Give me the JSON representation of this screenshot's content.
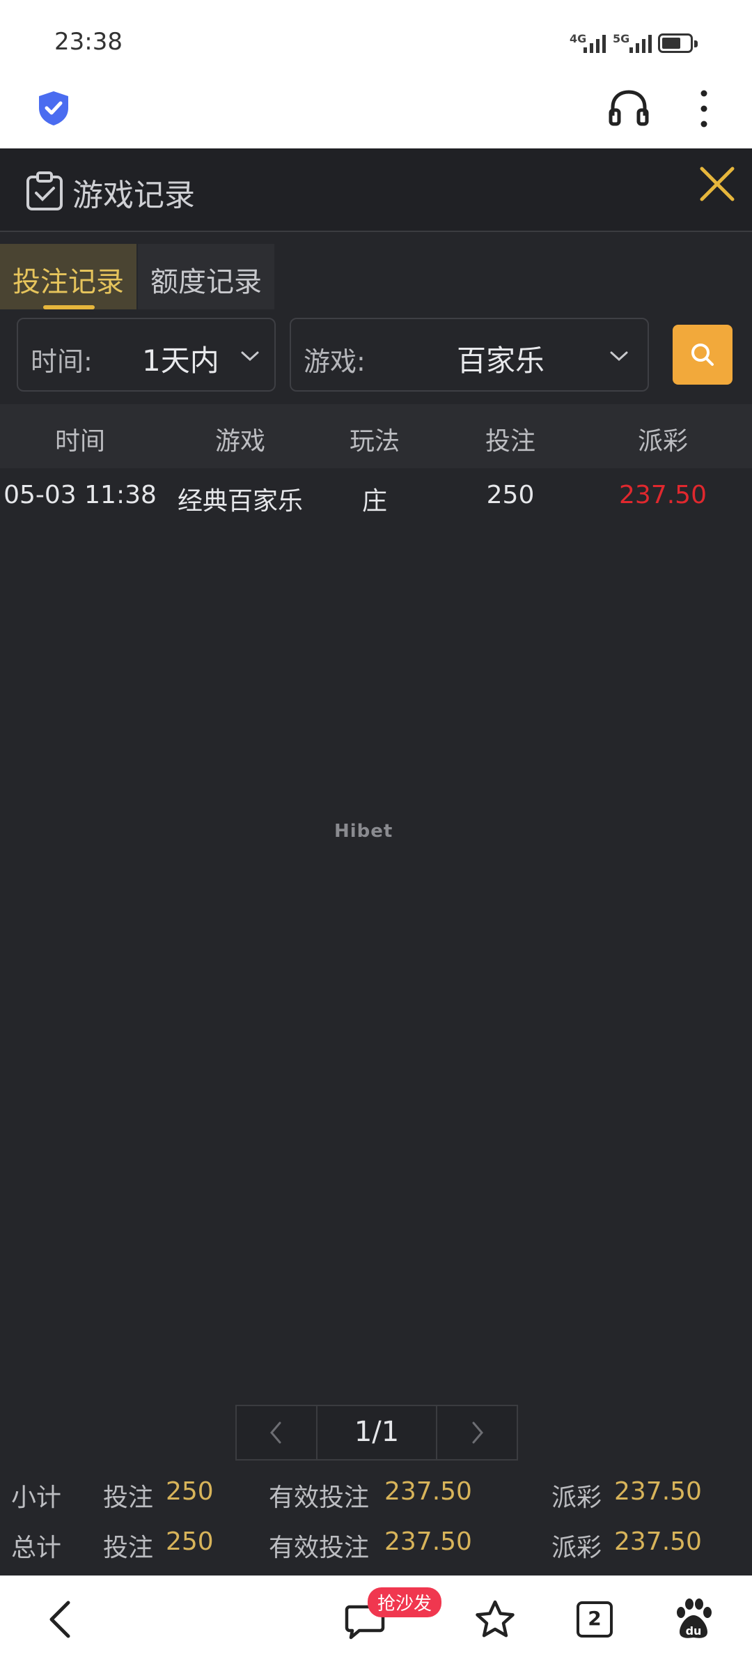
{
  "status_bar": {
    "time": "23:38",
    "net1": "4G",
    "net2": "5G"
  },
  "app": {
    "title": "游戏记录",
    "tabs": [
      {
        "label": "投注记录",
        "active": true
      },
      {
        "label": "额度记录",
        "active": false
      }
    ]
  },
  "filters": {
    "time_label": "时间:",
    "time_value": "1天内",
    "game_label": "游戏:",
    "game_value": "百家乐"
  },
  "table": {
    "headers": [
      "时间",
      "游戏",
      "玩法",
      "投注",
      "派彩"
    ],
    "rows": [
      {
        "time": "05-03 11:38",
        "game": "经典百家乐",
        "play": "庄",
        "bet": "250",
        "payout": "237.50"
      }
    ]
  },
  "watermark": "Hibet",
  "pagination": {
    "text": "1/1"
  },
  "totals": {
    "subtotal": {
      "label": "小计",
      "bet_label": "投注",
      "bet": "250",
      "valid_label": "有效投注",
      "valid": "237.50",
      "payout_label": "派彩",
      "payout": "237.50"
    },
    "total": {
      "label": "总计",
      "bet_label": "投注",
      "bet": "250",
      "valid_label": "有效投注",
      "valid": "237.50",
      "payout_label": "派彩",
      "payout": "237.50"
    }
  },
  "bottom_nav": {
    "badge": "抢沙发",
    "tab_count": "2"
  },
  "colors": {
    "accent": "#e6c45c",
    "search": "#f2a93b",
    "payout_red": "#e0282e",
    "bg": "#25262a"
  }
}
